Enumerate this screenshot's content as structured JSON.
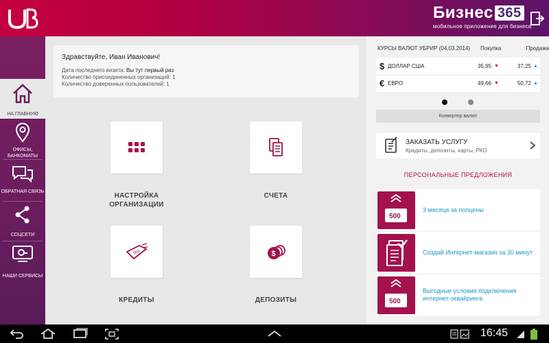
{
  "header": {
    "brand_title": "Бизнес",
    "brand_number": "365",
    "brand_subtitle": "мобильное приложение для бизнеса"
  },
  "sidebar": {
    "items": [
      {
        "label": "НА ГЛАВНУЮ",
        "icon": "home-icon",
        "active": true
      },
      {
        "label": "ОФИСЫ, БАНКОМАТЫ",
        "icon": "location-pin-icon"
      },
      {
        "label": "ОБРАТНАЯ СВЯЗЬ",
        "icon": "chat-bubbles-icon"
      },
      {
        "label": "СОЦСЕТИ",
        "icon": "share-icon"
      },
      {
        "label": "НАШИ СЕРВИСЫ",
        "icon": "services-icon"
      }
    ]
  },
  "welcome": {
    "greeting": "Здравствуйте, Иван Иванович!",
    "last_visit_label": "Дата последнего визита:",
    "last_visit_value": "Вы тут первый раз",
    "orgs_line": "Количество присоединенных организаций: 1",
    "trusted_line": "Количество доверенных пользователей: 1"
  },
  "tiles": [
    {
      "label": "НАСТРОЙКА ОРГАНИЗАЦИИ",
      "icon": "grid-icon"
    },
    {
      "label": "СЧЕТА",
      "icon": "documents-icon"
    },
    {
      "label": "КРЕДИТЫ",
      "icon": "money-tag-icon"
    },
    {
      "label": "ДЕПОЗИТЫ",
      "icon": "coins-icon"
    }
  ],
  "rates": {
    "title": "КУРСЫ ВАЛЮТ УБРИР (04.03.2014)",
    "buy_header": "Покупка",
    "sell_header": "Продажа",
    "rows": [
      {
        "symbol": "$",
        "name": "ДОЛЛАР США",
        "buy": "35,95",
        "buy_trend": "down",
        "sell": "37,25",
        "sell_trend": "up"
      },
      {
        "symbol": "€",
        "name": "ЕВРО",
        "buy": "49,66",
        "buy_trend": "down",
        "sell": "50,72",
        "sell_trend": "up"
      }
    ],
    "converter_label": "Конвертер валют"
  },
  "order": {
    "title": "ЗАКАЗАТЬ УСЛУГУ",
    "subtitle": "Кредиты, депозиты, карты, РКО"
  },
  "personal": {
    "title": "ПЕРСОНАЛЬНЫЕ ПРЕДЛОЖЕНИЯ",
    "offers": [
      {
        "text": "3 месяца за полцены",
        "badge": "500"
      },
      {
        "text": "Создай Интернет-магазин за 30 минут",
        "badge": ""
      },
      {
        "text": "Выгодные условия подключения интернет-эквайринга",
        "badge": "500"
      }
    ]
  },
  "system": {
    "time": "16:45"
  },
  "colors": {
    "accent": "#a3124d",
    "link": "#1b97c8",
    "up_arrow": "#1b97c8",
    "down_arrow": "#c2123e"
  }
}
